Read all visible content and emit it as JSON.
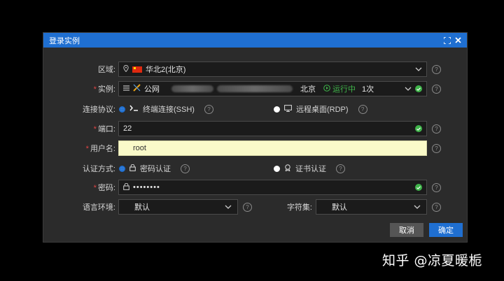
{
  "dialog": {
    "title": "登录实例"
  },
  "form": {
    "region": {
      "label": "区域:",
      "value": "华北2(北京)"
    },
    "instance": {
      "label": "实例:",
      "network": "公网",
      "city": "北京",
      "status": "运行中",
      "count": "1次"
    },
    "protocol": {
      "label": "连接协议:",
      "option_ssh": "终端连接(SSH)",
      "option_rdp": "远程桌面(RDP)",
      "selected": "终端连接(SSH)"
    },
    "port": {
      "label": "端口:",
      "value": "22"
    },
    "username": {
      "label": "用户名:",
      "value": "root"
    },
    "auth": {
      "label": "认证方式:",
      "option_password": "密码认证",
      "option_cert": "证书认证",
      "selected": "密码认证"
    },
    "password": {
      "label": "密码:",
      "value": "••••••••"
    },
    "locale": {
      "label": "语言环境:",
      "value": "默认"
    },
    "charset": {
      "label": "字符集:",
      "value": "默认"
    },
    "required_mark": "*",
    "help_glyph": "?"
  },
  "buttons": {
    "cancel": "取消",
    "confirm": "确定"
  },
  "watermark": "知乎 @凉夏暖栀",
  "colors": {
    "accent": "#1f6fd1",
    "success": "#3fb44a",
    "required": "#e04545",
    "highlight_field": "#fafac9"
  }
}
